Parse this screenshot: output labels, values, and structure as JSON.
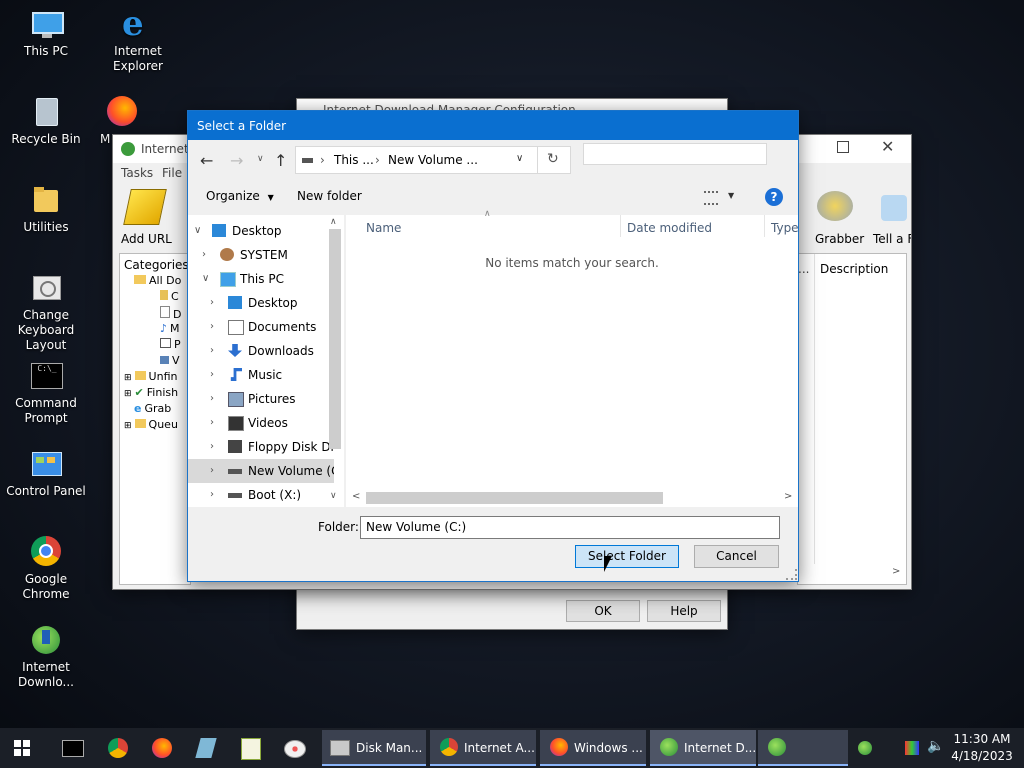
{
  "desktop": {
    "icons": [
      {
        "label": "This PC"
      },
      {
        "label": "Internet Explorer"
      },
      {
        "label": "Recycle Bin"
      },
      {
        "label": "Utilities"
      },
      {
        "label": "Change Keyboard Layout"
      },
      {
        "label": "Command Prompt"
      },
      {
        "label": "Control Panel"
      },
      {
        "label": "Google Chrome"
      },
      {
        "label": "Internet Downlo..."
      }
    ],
    "partial_label": "M"
  },
  "idm_config": {
    "title": "Internet Download Manager Configuration",
    "ok": "OK",
    "help": "Help"
  },
  "idm_main": {
    "title": "Internet",
    "menu": [
      "Tasks",
      "File"
    ],
    "toolbar": {
      "add_url": "Add URL",
      "grabber": "Grabber",
      "tell_friend": "Tell a Fri"
    },
    "categories_label": "Categories",
    "tree": [
      "All Do",
      "C",
      "D",
      "M",
      "P",
      "V",
      "Unfin",
      "Finish",
      "Grab",
      "Queu"
    ],
    "col_description": "Description",
    "col_dots": "..."
  },
  "dialog": {
    "title": "Select a Folder",
    "breadcrumb": [
      "This ...",
      "New Volume ..."
    ],
    "search_placeholder": "",
    "organize": "Organize",
    "new_folder": "New folder",
    "tree": [
      {
        "label": "Desktop",
        "level": 0,
        "chev": "v"
      },
      {
        "label": "SYSTEM",
        "level": 1,
        "chev": ">"
      },
      {
        "label": "This PC",
        "level": 1,
        "chev": "v"
      },
      {
        "label": "Desktop",
        "level": 2,
        "chev": ">"
      },
      {
        "label": "Documents",
        "level": 2,
        "chev": ">"
      },
      {
        "label": "Downloads",
        "level": 2,
        "chev": ">"
      },
      {
        "label": "Music",
        "level": 2,
        "chev": ">"
      },
      {
        "label": "Pictures",
        "level": 2,
        "chev": ">"
      },
      {
        "label": "Videos",
        "level": 2,
        "chev": ">"
      },
      {
        "label": "Floppy Disk Dri",
        "level": 2,
        "chev": ">"
      },
      {
        "label": "New Volume (C",
        "level": 2,
        "chev": ">"
      },
      {
        "label": "Boot (X:)",
        "level": 2,
        "chev": ">"
      }
    ],
    "columns": {
      "name": "Name",
      "date": "Date modified",
      "type": "Type"
    },
    "empty_message": "No items match your search.",
    "folder_label": "Folder:",
    "folder_value": "New Volume (C:)",
    "select_button": "Select Folder",
    "cancel_button": "Cancel"
  },
  "taskbar": {
    "tasks": [
      {
        "label": "Disk Man..."
      },
      {
        "label": "Internet A..."
      },
      {
        "label": "Windows ..."
      },
      {
        "label": "Internet D..."
      }
    ],
    "time": "11:30 AM",
    "date": "4/18/2023"
  },
  "colors": {
    "accent": "#0078d7",
    "titlebar_inactive": "#ffffff"
  }
}
